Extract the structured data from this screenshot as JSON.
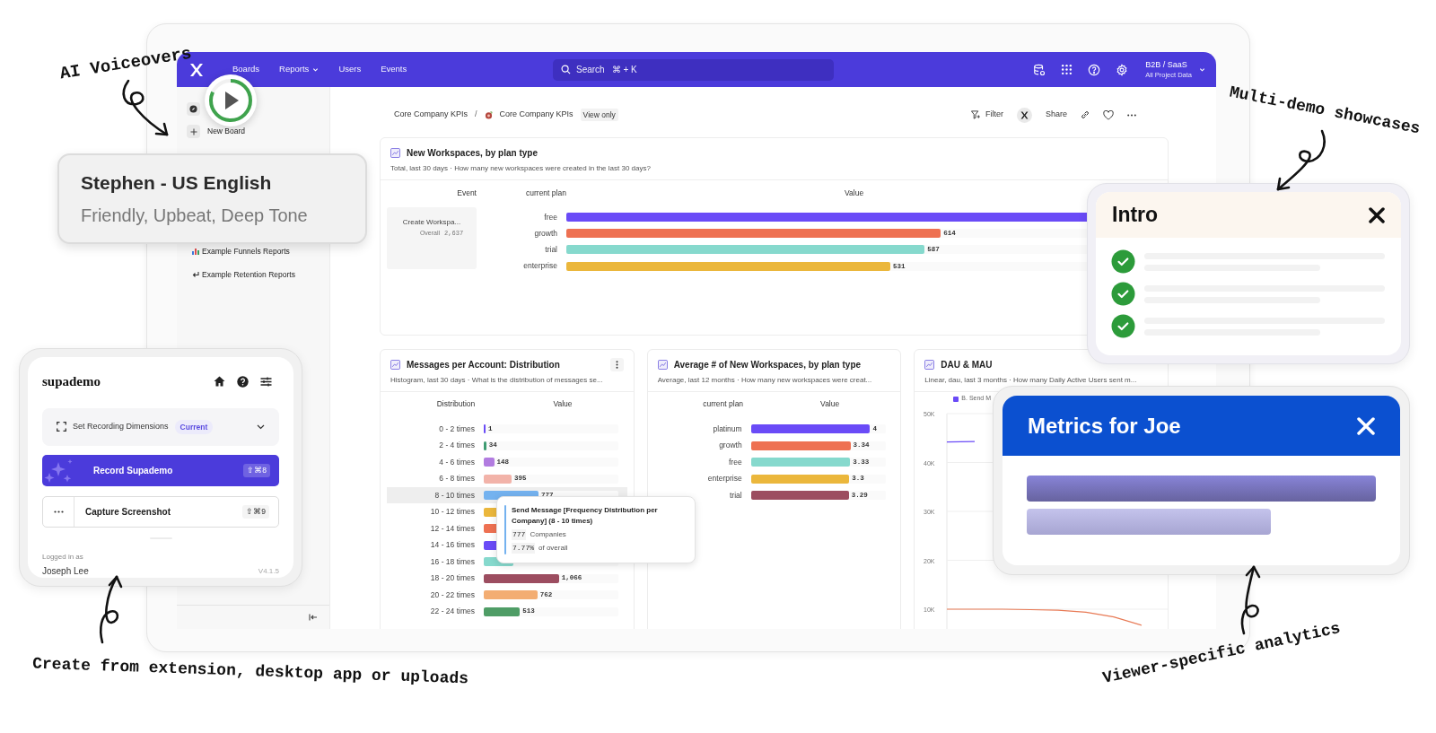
{
  "annotations": [
    {
      "text": "AI Voiceovers"
    },
    {
      "text": "Multi-demo showcases"
    },
    {
      "text": "Create from extension, desktop app or uploads"
    },
    {
      "text": "Viewer-specific analytics"
    }
  ],
  "app": {
    "nav": [
      {
        "label": "Boards",
        "dropdown": false
      },
      {
        "label": "Reports",
        "dropdown": true
      },
      {
        "label": "Users",
        "dropdown": false
      },
      {
        "label": "Events",
        "dropdown": false
      }
    ],
    "search": {
      "placeholder": "Search",
      "shortcut": "⌘ + K"
    },
    "toolbar_icons": [
      {
        "kind": "database"
      },
      {
        "kind": "apps"
      },
      {
        "kind": "help"
      },
      {
        "kind": "settings"
      }
    ],
    "project": {
      "name": "B2B / SaaS",
      "scope": "All Project Data"
    },
    "sidebar": {
      "items": [
        {
          "kind": "compass"
        },
        {
          "kind": "add",
          "label": "New Board"
        },
        {
          "kind": "funnels",
          "label": "Example Funnels Reports"
        },
        {
          "kind": "retention",
          "label": "Example Retention Reports"
        }
      ]
    },
    "breadcrumb": {
      "items": [
        "Core Company KPIs",
        "Core Company KPIs"
      ],
      "separator": "/",
      "badge": "View only"
    },
    "actions": [
      {
        "kind": "filter",
        "label": "Filter"
      },
      {
        "kind": "logo"
      },
      {
        "kind": "share",
        "label": "Share"
      },
      {
        "kind": "link"
      },
      {
        "kind": "heart"
      },
      {
        "kind": "more"
      }
    ],
    "main_card": {
      "title": "New Workspaces, by plan type",
      "subtitle": "Total, last 30 days · How many new workspaces were created in the last 30 days?",
      "columns": [
        "Event",
        "current plan",
        "Value"
      ],
      "event": {
        "name": "Create Workspa...",
        "scope": "Overall",
        "total": "2,637"
      },
      "rows": [
        {
          "label": "free",
          "level": 0.98,
          "color": "#6a4bf7"
        },
        {
          "label": "growth",
          "value": "614",
          "level": 0.674,
          "color": "#ee7152"
        },
        {
          "label": "trial",
          "value": "587",
          "level": 0.645,
          "color": "#86d9cd"
        },
        {
          "label": "enterprise",
          "value": "531",
          "level": 0.583,
          "color": "#ebb73c"
        }
      ]
    },
    "distribution_card": {
      "title": "Messages per Account: Distribution",
      "subtitle": "Histogram, last 30 days · What is the distribution of messages se...",
      "columns": [
        "Distribution",
        "Value"
      ],
      "rows": [
        {
          "label": "0 - 2 times",
          "value": "1",
          "level": 0.002,
          "color": "#6a4bf7",
          "selected": false
        },
        {
          "label": "2 - 4 times",
          "value": "34",
          "level": 0.018,
          "color": "#3e9c72",
          "selected": false
        },
        {
          "label": "4 - 6 times",
          "value": "148",
          "level": 0.077,
          "color": "#b27ce0",
          "selected": false
        },
        {
          "label": "6 - 8 times",
          "value": "395",
          "level": 0.207,
          "color": "#f2b3a9",
          "selected": false
        },
        {
          "label": "8 - 10 times",
          "value": "777",
          "level": 0.407,
          "color": "#74b2ef",
          "selected": true
        },
        {
          "label": "10 - 12 times",
          "level": 0.25,
          "color": "#ebb73c",
          "selected": false
        },
        {
          "label": "12 - 14 times",
          "level": 0.25,
          "color": "#ee7152",
          "selected": false
        },
        {
          "label": "14 - 16 times",
          "level": 0.2,
          "color": "#6a4bf7",
          "selected": false
        },
        {
          "label": "16 - 18 times",
          "level": 0.22,
          "color": "#86d9cd",
          "selected": false
        },
        {
          "label": "18 - 20 times",
          "value": "1,066",
          "level": 0.558,
          "color": "#9c4d60",
          "selected": false
        },
        {
          "label": "20 - 22 times",
          "value": "762",
          "level": 0.399,
          "color": "#f3ad72",
          "selected": false
        },
        {
          "label": "22 - 24 times",
          "value": "513",
          "level": 0.269,
          "color": "#4f9d66",
          "selected": false
        }
      ],
      "tooltip": {
        "title": "Send Message [Frequency Distribution per Company] (8 - 10 times)",
        "lines": [
          {
            "value": "777",
            "label": "Companies"
          },
          {
            "value": "7.77%",
            "label": "of overall"
          }
        ]
      }
    },
    "average_card": {
      "title": "Average # of New Workspaces, by plan type",
      "subtitle": "Average, last 12 months · How many new workspaces were creat...",
      "columns": [
        "current plan",
        "Value"
      ],
      "rows": [
        {
          "label": "platinum",
          "value": "4",
          "level": 0.885,
          "color": "#6a4bf7"
        },
        {
          "label": "growth",
          "value": "3.34",
          "level": 0.739,
          "color": "#ee7152"
        },
        {
          "label": "free",
          "value": "3.33",
          "level": 0.737,
          "color": "#86d9cd"
        },
        {
          "label": "enterprise",
          "value": "3.3",
          "level": 0.73,
          "color": "#ebb73c"
        },
        {
          "label": "trial",
          "value": "3.29",
          "level": 0.728,
          "color": "#9c4d60"
        }
      ]
    },
    "dau_card": {
      "title": "DAU & MAU",
      "subtitle": "Linear, dau, last 3 months · How many Daily Active Users sent m...",
      "chart_data": {
        "type": "line",
        "grid": true,
        "ylim": [
          5000,
          50000
        ],
        "yticks": [
          {
            "value": 50000,
            "label": "50K"
          },
          {
            "value": 40000,
            "label": "40K"
          },
          {
            "value": 30000,
            "label": "30K"
          },
          {
            "value": 20000,
            "label": "20K"
          },
          {
            "value": 10000,
            "label": "10K"
          }
        ],
        "series": [
          {
            "name": "B. Send M",
            "color": "#6a4bf7",
            "values": [
              44200,
              44300,
              null,
              null,
              null,
              null,
              null,
              null,
              null
            ]
          },
          {
            "color": "#e87a55",
            "values": [
              10000,
              10000,
              10000,
              9900,
              9800,
              9400,
              8400,
              6700,
              null
            ]
          }
        ]
      }
    }
  },
  "voiceover": {
    "voice": "Stephen - US English",
    "style": "Friendly, Upbeat, Deep Tone",
    "progress": {
      "level": 0.82
    }
  },
  "extension": {
    "brand": "supademo",
    "icons": [
      {
        "kind": "home"
      },
      {
        "kind": "help"
      },
      {
        "kind": "sliders"
      }
    ],
    "dimensions": {
      "label": "Set Recording Dimensions",
      "badge": "Current"
    },
    "buttons": [
      {
        "kind": "primary",
        "label": "Record Supademo",
        "shortcut": "⇧⌘8"
      },
      {
        "kind": "secondary",
        "label": "Capture Screenshot",
        "shortcut": "⇧⌘9"
      }
    ],
    "login_label": "Logged in as",
    "user": "Joseph Lee",
    "version": "V4.1.5"
  },
  "intro": {
    "title": "Intro",
    "items": [
      {
        "checked": true
      },
      {
        "checked": true
      },
      {
        "checked": true
      }
    ]
  },
  "metrics": {
    "title": "Metrics for Joe"
  }
}
